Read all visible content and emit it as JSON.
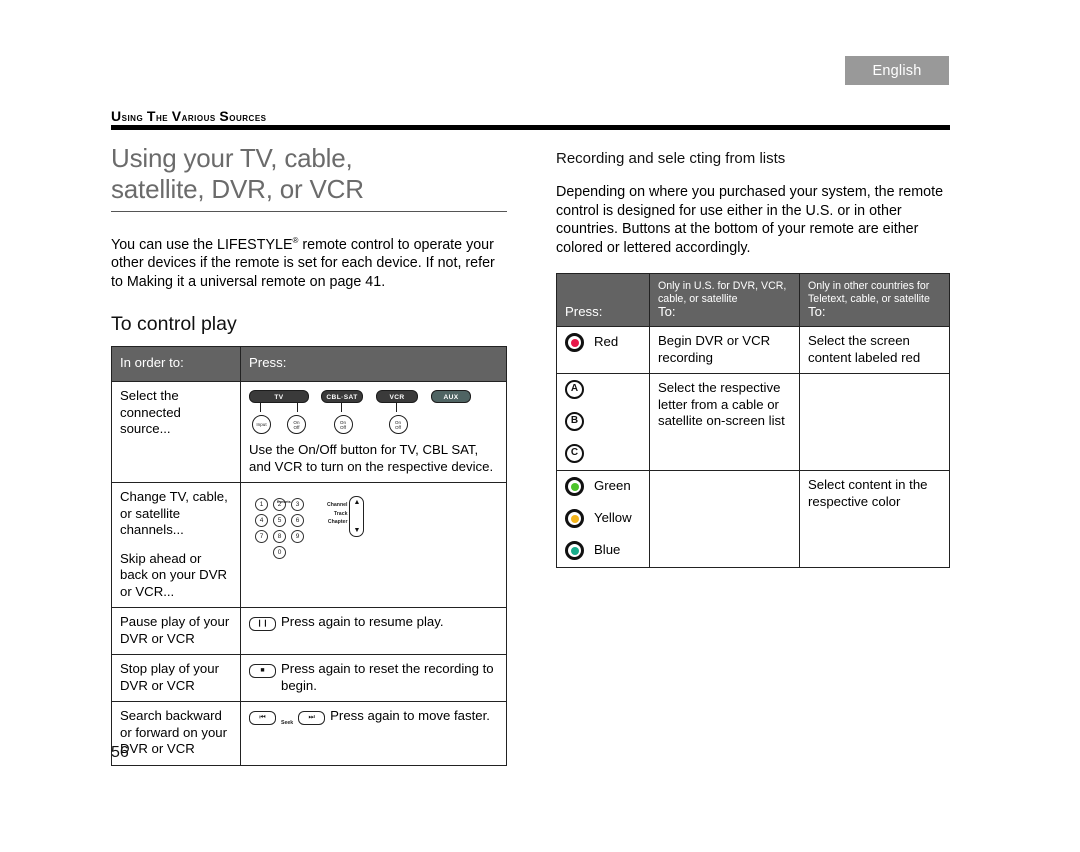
{
  "language_tab": "English",
  "running_head": "USING THE VARIOUS SOURCES",
  "page_number": "56",
  "left_column": {
    "title_line1": "Using your TV, cable,",
    "title_line2": "satellite, DVR, or VCR",
    "intro": "You can use the LIFESTYLE remote control to operate your other devices if the remote is set for each device. If not, refer to  Making  it a universal remote  on page 41.",
    "intro_superscript": "®",
    "subhead": "To control play",
    "table": {
      "headers": [
        "In order to:",
        "Press:"
      ],
      "rows": [
        {
          "order_to": "Select the connected source...",
          "press_note": "Use the On/Off button for TV, CBL SAT, and VCR to turn on the respective device.",
          "source_buttons": [
            {
              "cap": "TV",
              "style": "dark",
              "circles": [
                "Input",
                "On\nOff"
              ]
            },
            {
              "cap": "CBL·SAT",
              "style": "dark",
              "circles": [
                "On\nOff"
              ]
            },
            {
              "cap": "VCR",
              "style": "dark",
              "circles": [
                "On\nOff"
              ]
            },
            {
              "cap": "AUX",
              "style": "aux",
              "circles": []
            }
          ]
        },
        {
          "order_to_line1": "Change TV, cable, or satellite channels...",
          "order_to_line2": "Skip ahead or back on your DVR or VCR...",
          "keypad": {
            "presets_label": "Presets",
            "keys": [
              "1",
              "2",
              "3",
              "4",
              "5",
              "6",
              "7",
              "8",
              "9",
              "0"
            ],
            "rocker_labels": [
              "Channel",
              "Track",
              "Chapter"
            ],
            "rocker_up": "▲",
            "rocker_down": "▼"
          }
        },
        {
          "order_to": "Pause play of your DVR or VCR",
          "button_glyph": "❙❙",
          "press_text": "Press again to resume play."
        },
        {
          "order_to": "Stop play of your DVR or VCR",
          "button_glyph": "■",
          "press_text": "Press again to reset the recording to begin."
        },
        {
          "order_to": "Search backward or forward on your DVR or VCR",
          "button_glyph_back": "⏮",
          "seek_label": "Seek",
          "button_glyph_fwd": "⏭",
          "press_text": "Press again to move faster."
        }
      ]
    }
  },
  "right_column": {
    "subhead": "Recording and sele  cting from lists",
    "paragraph": "Depending on where you purchased your system, the remote control is designed for use either in the U.S. or in other countries. Buttons at the bottom of your remote are either colored or lettered accordingly.",
    "table": {
      "headers": [
        {
          "label": "Press:",
          "note": ""
        },
        {
          "label": "To:",
          "note": "Only in U.S. for DVR, VCR, cable, or satellite"
        },
        {
          "label": "To:",
          "note": "Only in other countries for Teletext, cable, or satellite"
        }
      ],
      "rows": [
        {
          "buttons": [
            {
              "type": "color",
              "label": "Red",
              "color": "#E8174A"
            }
          ],
          "us": "Begin DVR or VCR recording",
          "other": "Select the screen content labeled red"
        },
        {
          "buttons": [
            {
              "type": "letter",
              "label": "A"
            },
            {
              "type": "letter",
              "label": "B"
            },
            {
              "type": "letter",
              "label": "C"
            }
          ],
          "us": "Select the respective letter from a cable or satellite on-screen list",
          "other": ""
        },
        {
          "buttons": [
            {
              "type": "color",
              "label": "Green",
              "color": "#4CC42A"
            },
            {
              "type": "color",
              "label": "Yellow",
              "color": "#F5B51B"
            },
            {
              "type": "color",
              "label": "Blue",
              "color": "#17AE8C"
            }
          ],
          "us": "",
          "other": "Select content in the respective color"
        }
      ]
    }
  }
}
